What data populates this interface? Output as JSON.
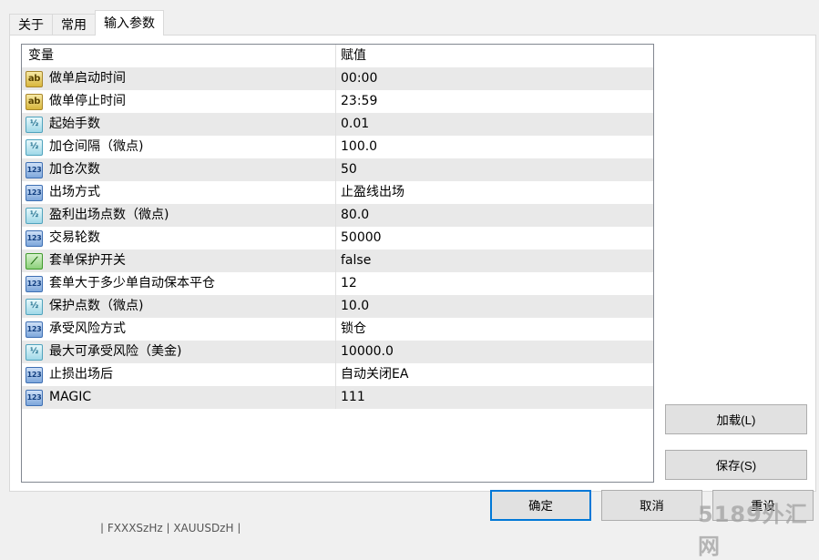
{
  "tabs": [
    {
      "label": "关于"
    },
    {
      "label": "常用"
    },
    {
      "label": "输入参数"
    }
  ],
  "grid": {
    "headers": {
      "variable": "变量",
      "value": "赋值"
    },
    "rows": [
      {
        "icon": "ab",
        "name": "做单启动时间",
        "value": "00:00"
      },
      {
        "icon": "ab",
        "name": "做单停止时间",
        "value": "23:59"
      },
      {
        "icon": "half",
        "name": "起始手数",
        "value": "0.01"
      },
      {
        "icon": "half",
        "name": "加仓间隔（微点)",
        "value": "100.0"
      },
      {
        "icon": "num",
        "name": "加仓次数",
        "value": "50"
      },
      {
        "icon": "num",
        "name": "出场方式",
        "value": "止盈线出场"
      },
      {
        "icon": "half",
        "name": "盈利出场点数（微点)",
        "value": "80.0"
      },
      {
        "icon": "num",
        "name": "交易轮数",
        "value": "50000"
      },
      {
        "icon": "bool",
        "name": "套单保护开关",
        "value": "false"
      },
      {
        "icon": "num",
        "name": "套单大于多少单自动保本平仓",
        "value": "12"
      },
      {
        "icon": "half",
        "name": "保护点数（微点)",
        "value": "10.0"
      },
      {
        "icon": "num",
        "name": "承受风险方式",
        "value": "锁仓"
      },
      {
        "icon": "half",
        "name": "最大可承受风险（美金)",
        "value": "10000.0"
      },
      {
        "icon": "num",
        "name": "止损出场后",
        "value": "自动关闭EA"
      },
      {
        "icon": "num",
        "name": "MAGIC",
        "value": "111"
      }
    ]
  },
  "icons": {
    "ab": "ab",
    "half": "½",
    "num": "123",
    "bool": "⟋"
  },
  "buttons": {
    "load": "加载(L)",
    "save": "保存(S)",
    "ok": "确定",
    "cancel": "取消",
    "reset": "重设"
  },
  "watermark": "5189外汇网",
  "background_text": "|  FXXXSzHz  |  XAUUSDzH  |"
}
